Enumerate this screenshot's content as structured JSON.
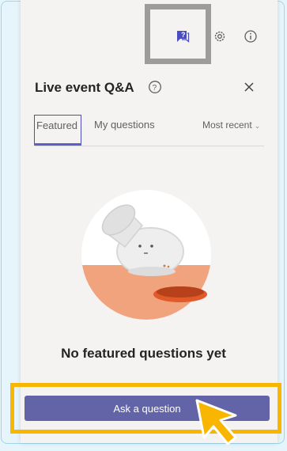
{
  "panel": {
    "title": "Live event Q&A",
    "toolbar": {
      "qa_icon": "qa-chat-icon",
      "settings_icon": "gear-icon",
      "info_icon": "info-icon"
    },
    "help_icon": "help-circle-icon",
    "close_icon": "close-icon"
  },
  "tabs": [
    {
      "label": "Featured",
      "selected": true
    },
    {
      "label": "My questions",
      "selected": false
    }
  ],
  "sort": {
    "label": "Most recent",
    "icon": "chevron-down-icon"
  },
  "empty_state": {
    "message": "No featured questions yet"
  },
  "cta": {
    "label": "Ask a question"
  },
  "colors": {
    "accent": "#6264a7",
    "highlight": "#f8b600",
    "frame_gray": "#9c9c9c",
    "background": "#e6f5fb"
  }
}
